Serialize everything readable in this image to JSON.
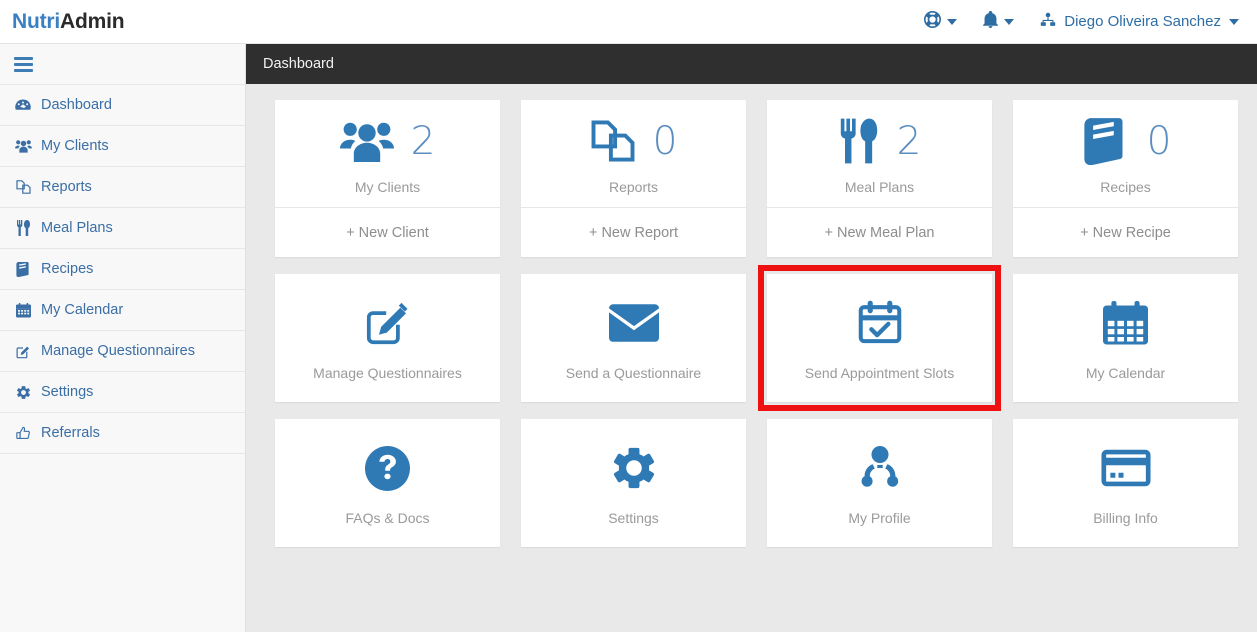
{
  "brand": {
    "part1": "Nutri",
    "part2": "Admin"
  },
  "header": {
    "support_icon": "life-ring-icon",
    "notifications_icon": "bell-icon",
    "user_icon": "user-avatar-icon",
    "username": "Diego Oliveira Sanchez",
    "caret_icon": "caret-down-icon"
  },
  "sidebar": {
    "toggle_icon": "hamburger-icon",
    "items": [
      {
        "label": "Dashboard",
        "icon": "dashboard-icon"
      },
      {
        "label": "My Clients",
        "icon": "users-icon"
      },
      {
        "label": "Reports",
        "icon": "files-icon"
      },
      {
        "label": "Meal Plans",
        "icon": "cutlery-icon"
      },
      {
        "label": "Recipes",
        "icon": "book-icon"
      },
      {
        "label": "My Calendar",
        "icon": "calendar-icon"
      },
      {
        "label": "Manage Questionnaires",
        "icon": "edit-square-icon"
      },
      {
        "label": "Settings",
        "icon": "gear-icon"
      },
      {
        "label": "Referrals",
        "icon": "thumbs-up-icon"
      }
    ]
  },
  "page": {
    "title": "Dashboard"
  },
  "colors": {
    "accent_blue": "#2f79b5",
    "link_blue": "#3a6ea5",
    "highlight_red": "#ee1111",
    "page_bg": "#e9e9e9",
    "header_bar": "#2f2f2f"
  },
  "stat_cards": [
    {
      "label": "My Clients",
      "count": "2",
      "icon": "users-icon",
      "action": "+ New Client"
    },
    {
      "label": "Reports",
      "count": "0",
      "icon": "files-icon",
      "action": "+ New Report"
    },
    {
      "label": "Meal Plans",
      "count": "2",
      "icon": "cutlery-icon",
      "action": "+ New Meal Plan"
    },
    {
      "label": "Recipes",
      "count": "0",
      "icon": "book-icon",
      "action": "+ New Recipe"
    }
  ],
  "action_cards_row1": [
    {
      "label": "Manage Questionnaires",
      "icon": "edit-square-icon",
      "highlighted": false
    },
    {
      "label": "Send a Questionnaire",
      "icon": "envelope-icon",
      "highlighted": false
    },
    {
      "label": "Send Appointment Slots",
      "icon": "calendar-check-icon",
      "highlighted": true
    },
    {
      "label": "My Calendar",
      "icon": "calendar-icon",
      "highlighted": false
    }
  ],
  "action_cards_row2": [
    {
      "label": "FAQs & Docs",
      "icon": "question-circle-icon",
      "highlighted": false
    },
    {
      "label": "Settings",
      "icon": "gear-icon",
      "highlighted": false
    },
    {
      "label": "My Profile",
      "icon": "user-doctor-icon",
      "highlighted": false
    },
    {
      "label": "Billing Info",
      "icon": "credit-card-icon",
      "highlighted": false
    }
  ]
}
